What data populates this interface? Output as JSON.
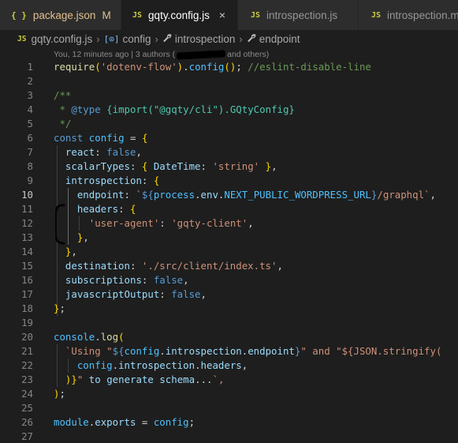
{
  "tabs": [
    {
      "icon": "{ }",
      "label": "package.json",
      "badge": "M",
      "active": false
    },
    {
      "icon": "JS",
      "label": "gqty.config.js",
      "close": "×",
      "active": true
    },
    {
      "icon": "JS",
      "label": "introspection.js",
      "active": false
    },
    {
      "icon": "JS",
      "label": "introspection.m",
      "active": false
    }
  ],
  "breadcrumb": {
    "file_icon": "JS",
    "file": "gqty.config.js",
    "items": [
      "config",
      "introspection",
      "endpoint"
    ],
    "object_icon": "[⊙]",
    "separator": "›"
  },
  "blame": {
    "prefix": "You, 12 minutes ago",
    "authors": "| 3 authors (",
    "suffix": "and others)"
  },
  "current_line": 10,
  "lines": [
    {
      "n": "1",
      "t": "require('dotenv-flow').config(); //eslint-disable-line"
    },
    {
      "n": "2",
      "t": ""
    },
    {
      "n": "3",
      "t": "/**"
    },
    {
      "n": "4",
      "t": " * @type {import(\"@gqty/cli\").GQtyConfig}"
    },
    {
      "n": "5",
      "t": " */"
    },
    {
      "n": "6",
      "t": "const config = {"
    },
    {
      "n": "7",
      "t": "  react: false,"
    },
    {
      "n": "8",
      "t": "  scalarTypes: { DateTime: 'string' },"
    },
    {
      "n": "9",
      "t": "  introspection: {"
    },
    {
      "n": "10",
      "t": "    endpoint: `${process.env.NEXT_PUBLIC_WORDPRESS_URL}/graphql`,"
    },
    {
      "n": "11",
      "t": "    headers: {"
    },
    {
      "n": "12",
      "t": "      'user-agent': 'gqty-client',"
    },
    {
      "n": "13",
      "t": "    },"
    },
    {
      "n": "14",
      "t": "  },"
    },
    {
      "n": "15",
      "t": "  destination: './src/client/index.ts',"
    },
    {
      "n": "16",
      "t": "  subscriptions: false,"
    },
    {
      "n": "17",
      "t": "  javascriptOutput: false,"
    },
    {
      "n": "18",
      "t": "};"
    },
    {
      "n": "19",
      "t": ""
    },
    {
      "n": "20",
      "t": "console.log("
    },
    {
      "n": "21",
      "t": "  `Using \"${config.introspection.endpoint}\" and \"${JSON.stringify("
    },
    {
      "n": "22",
      "t": "    config.introspection.headers,"
    },
    {
      "n": "23",
      "t": "  )}\" to generate schema...`,"
    },
    {
      "n": "24",
      "t": ");"
    },
    {
      "n": "25",
      "t": ""
    },
    {
      "n": "26",
      "t": "module.exports = config;"
    },
    {
      "n": "27",
      "t": ""
    }
  ]
}
